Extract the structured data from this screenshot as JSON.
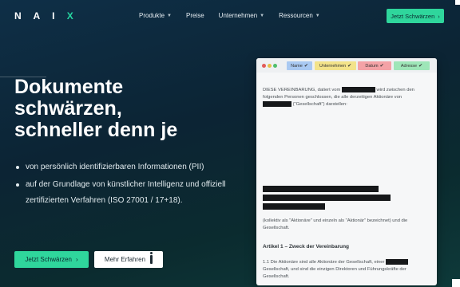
{
  "nav": {
    "logo": "NAIX",
    "menu": [
      {
        "label": "Produkte",
        "has_dropdown": true
      },
      {
        "label": "Preise",
        "has_dropdown": false
      },
      {
        "label": "Unternehmen",
        "has_dropdown": true
      },
      {
        "label": "Ressourcen",
        "has_dropdown": true
      }
    ],
    "cta": "Jetzt Schwärzen",
    "cta_icon": "chevron-right-icon"
  },
  "hero": {
    "headline_lines": [
      "Dokumente",
      "schwärzen,",
      "schneller denn je"
    ],
    "bullets": [
      "von persönlich identifizierbaren Informationen (PII)",
      "auf der Grundlage von künstlicher Intelligenz und offiziell zertifizierten Verfahren (ISO 27001 / 17+18)."
    ],
    "primary_button": "Jetzt Schwärzen",
    "secondary_button": "Mehr Erfahren",
    "secondary_icon": "info-icon"
  },
  "document": {
    "tags": [
      "Name",
      "Unternehmen",
      "Datum",
      "Adresse"
    ],
    "paragraph1_a": "DIESE VEREINBARUNG, datiert vom",
    "paragraph1_b": "wird zwischen den folgenden Personen geschlossen, die alle derzeitigen Aktionäre von",
    "paragraph1_c": "(\"Gesellschaft\") darstellen:",
    "paragraph2": "(kollektiv als \"Aktionäre\" und einzeln als \"Aktionär\" bezeichnet) und die Gesellschaft.",
    "article_title": "Artikel 1 – Zweck der Vereinbarung",
    "paragraph3_a": "1.1 Die Aktionäre sind alle Aktionäre der Gesellschaft, einer",
    "paragraph3_b": "Gesellschaft, und sind die einzigen Direktoren und Führungskräfte der Gesellschaft."
  },
  "colors": {
    "accent": "#2fd69c",
    "background": "#0c2434",
    "tag_name": "#a9c9f2",
    "tag_company": "#f3e38a",
    "tag_date": "#f4a2a6",
    "tag_address": "#9ee6b8"
  }
}
